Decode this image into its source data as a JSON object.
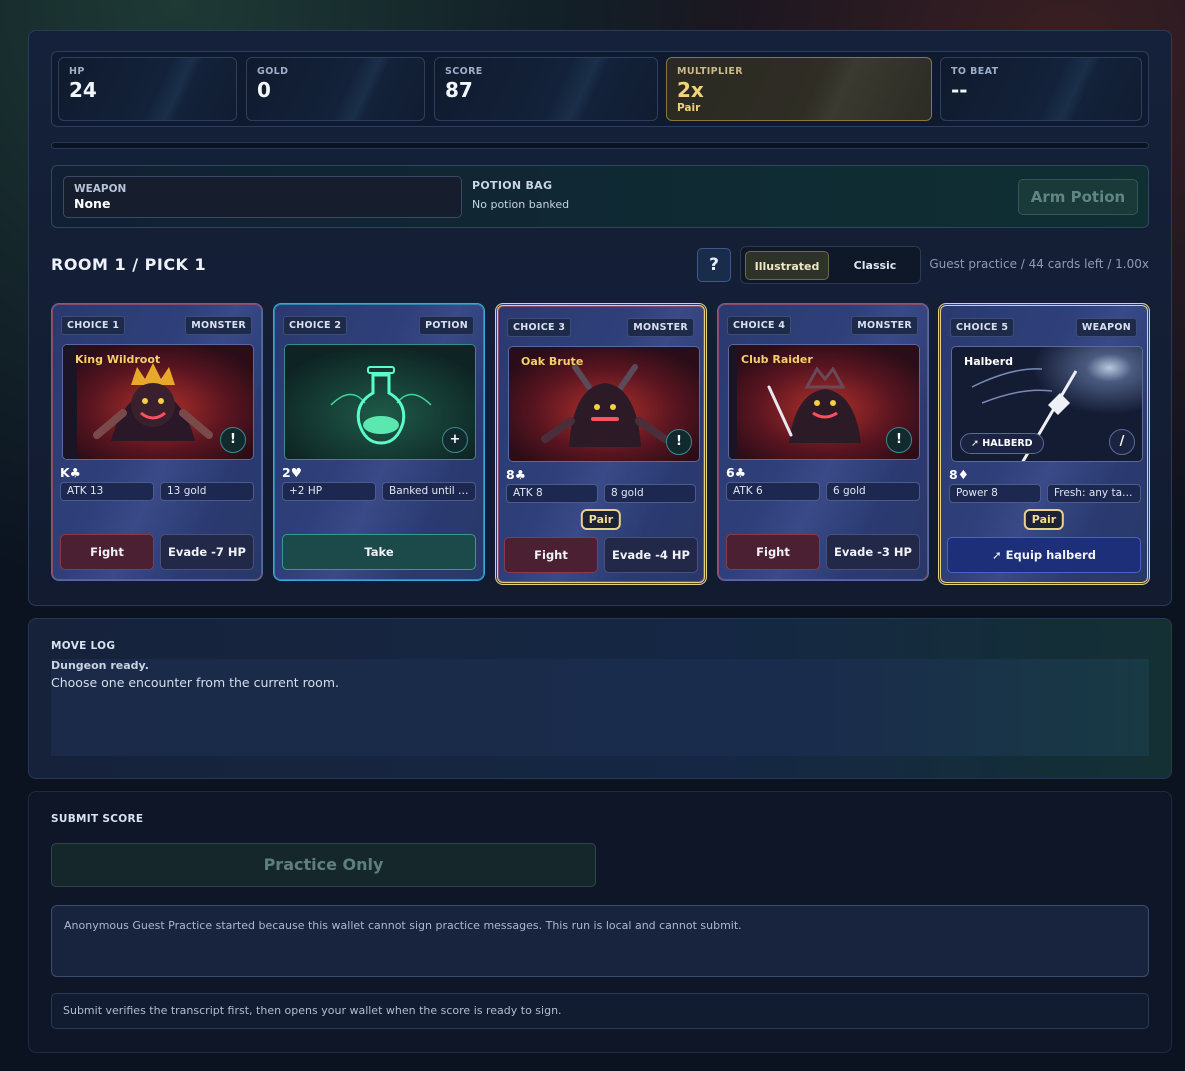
{
  "stats": {
    "hp": {
      "label": "HP",
      "value": "24"
    },
    "gold": {
      "label": "GOLD",
      "value": "0"
    },
    "score": {
      "label": "SCORE",
      "value": "87"
    },
    "multiplier": {
      "label": "MULTIPLIER",
      "value": "2x",
      "sub": "Pair"
    },
    "to_beat": {
      "label": "TO BEAT",
      "value": "--"
    },
    "progress": 0
  },
  "inventory": {
    "weapon_label": "WEAPON",
    "weapon_value": "None",
    "potion_label": "POTION BAG",
    "potion_value": "No potion banked",
    "arm_potion": "Arm Potion"
  },
  "room": {
    "title": "ROOM 1 / PICK 1",
    "help": "?",
    "mode_illustrated": "Illustrated",
    "mode_classic": "Classic",
    "info": "Guest practice / 44 cards left / 1.00x"
  },
  "cards": [
    {
      "choice": "CHOICE 1",
      "type": "MONSTER",
      "name": "King Wildroot",
      "badge": "!",
      "rank": "K♣",
      "chip1": "ATK 13",
      "chip2": "13 gold",
      "btn1": "Fight",
      "btn2": "Evade -7 HP"
    },
    {
      "choice": "CHOICE 2",
      "type": "POTION",
      "name": "",
      "badge": "+",
      "rank": "2♥",
      "chip1": "+2 HP",
      "chip2": "Banked until …",
      "btn1": "Take"
    },
    {
      "choice": "CHOICE 3",
      "type": "MONSTER",
      "name": "Oak Brute",
      "badge": "!",
      "rank": "8♣",
      "chip1": "ATK 8",
      "chip2": "8 gold",
      "pair": "Pair",
      "btn1": "Fight",
      "btn2": "Evade -4 HP"
    },
    {
      "choice": "CHOICE 4",
      "type": "MONSTER",
      "name": "Club Raider",
      "badge": "!",
      "rank": "6♣",
      "chip1": "ATK 6",
      "chip2": "6 gold",
      "btn1": "Fight",
      "btn2": "Evade -3 HP"
    },
    {
      "choice": "CHOICE 5",
      "type": "WEAPON",
      "name": "Halberd",
      "badge": "/",
      "weapon_tag": "HALBERD",
      "rank": "8♦",
      "chip1": "Power 8",
      "chip2": "Fresh: any tar…",
      "pair": "Pair",
      "btn1": "Equip halberd"
    }
  ],
  "log": {
    "title": "MOVE LOG",
    "head": "Dungeon ready.",
    "line": "Choose one encounter from the current room."
  },
  "submit": {
    "title": "SUBMIT SCORE",
    "button": "Practice Only",
    "notice": "Anonymous Guest Practice started because this wallet cannot sign practice messages. This run is local and cannot submit.",
    "hint": "Submit verifies the transcript first, then opens your wallet when the score is ready to sign."
  },
  "colors": {
    "accent_gold": "#f3d27e",
    "fight": "#4a2032",
    "equip": "#1e2f7a",
    "take": "#1c4a4a"
  }
}
